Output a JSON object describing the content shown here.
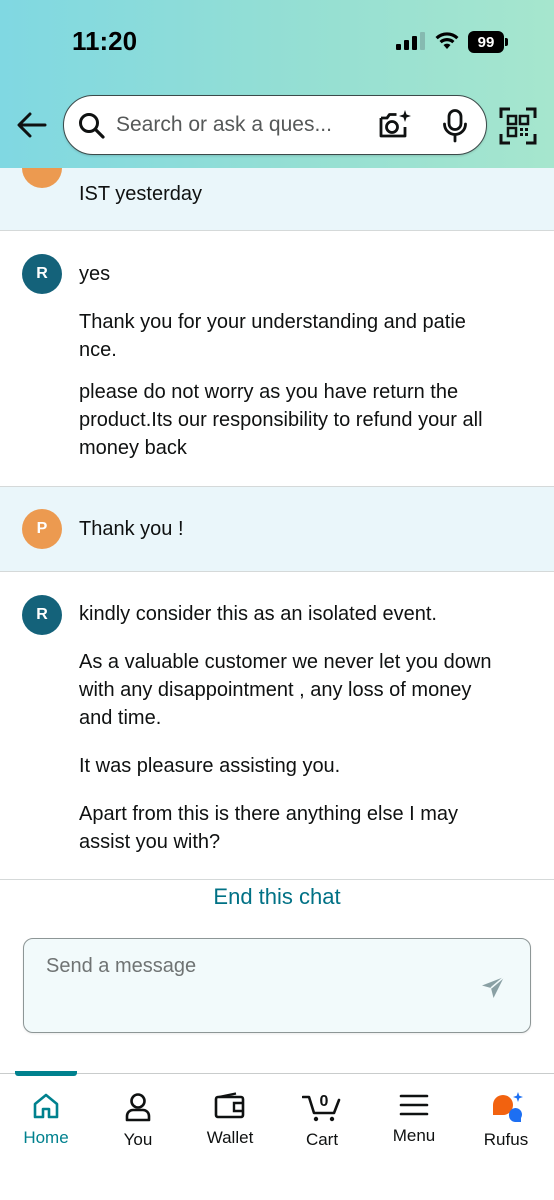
{
  "status_bar": {
    "time": "11:20",
    "battery": "99"
  },
  "search": {
    "placeholder": "Search or ask a ques..."
  },
  "chat": {
    "partial_message": "IST yesterday",
    "messages": [
      {
        "sender": "R",
        "lines": [
          "yes",
          "Thank you for your understanding and patie",
          "nce.",
          "please do not worry as you have return the",
          "product.Its our responsibility to refund your all",
          "money back"
        ]
      },
      {
        "sender": "P",
        "lines": [
          "Thank you !"
        ]
      },
      {
        "sender": "R",
        "lines": [
          "kindly consider this as an isolated event.",
          "As a valuable customer we never let you down",
          "with any disappointment , any loss of money",
          "and time.",
          "It was pleasure assisting you.",
          "Apart from this is there anything else I may",
          "assist you with?"
        ]
      }
    ],
    "end_chat_label": "End this chat",
    "composer_placeholder": "Send a message"
  },
  "nav": {
    "items": [
      {
        "label": "Home",
        "icon": "home-icon",
        "active": true
      },
      {
        "label": "You",
        "icon": "person-icon"
      },
      {
        "label": "Wallet",
        "icon": "wallet-icon"
      },
      {
        "label": "Cart",
        "icon": "cart-icon",
        "count": "0"
      },
      {
        "label": "Menu",
        "icon": "menu-icon"
      },
      {
        "label": "Rufus",
        "icon": "rufus-icon"
      }
    ]
  },
  "colors": {
    "header_gradient_start": "#80d8e2",
    "header_gradient_end": "#a6e6ce",
    "agent_avatar": "#14627a",
    "user_avatar": "#ec9a50",
    "user_message_bg": "#eaf6fa",
    "link": "#007185",
    "active_nav": "#00818e"
  }
}
